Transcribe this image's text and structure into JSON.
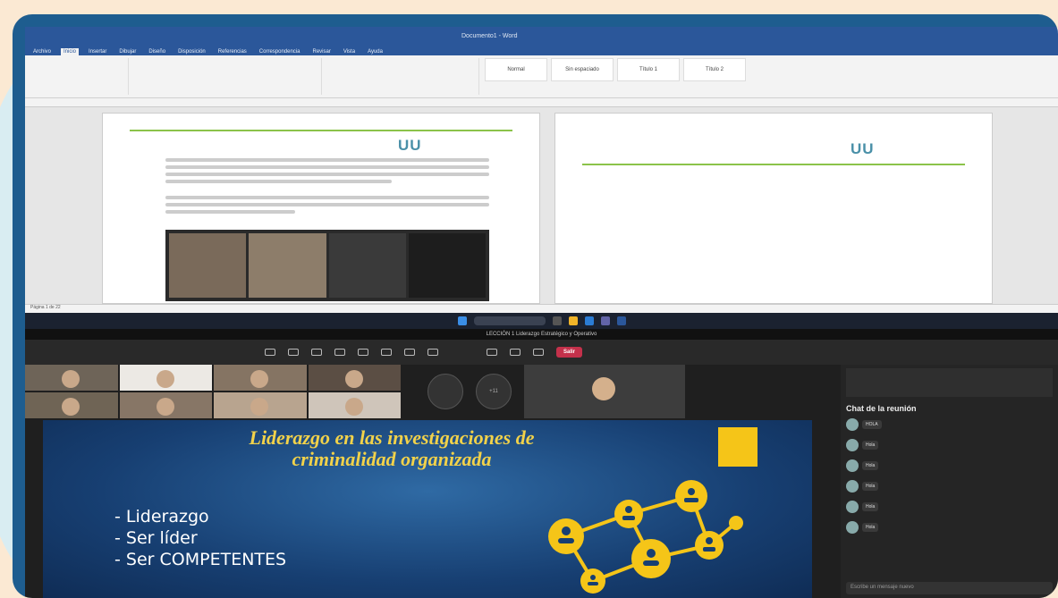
{
  "word": {
    "title": "Documento1 - Word",
    "tabs": [
      "Archivo",
      "Inicio",
      "Insertar",
      "Dibujar",
      "Diseño",
      "Disposición",
      "Referencias",
      "Correspondencia",
      "Revisar",
      "Vista",
      "Ayuda"
    ],
    "active_tab": "Inicio",
    "styles": [
      "Normal",
      "Sin espaciado",
      "Título 1",
      "Título 2"
    ],
    "logo_text": "UU",
    "statusbar": "Página 1 de 22"
  },
  "teams": {
    "meeting_title": "LECCIÓN 1 Liderazgo Estratégico y Operativo",
    "leave_label": "Salir",
    "participant_more": "+11",
    "chat_title": "Chat de la reunión",
    "compose_placeholder": "Escribe un mensaje nuevo",
    "messages": [
      {
        "text": "HOLA"
      },
      {
        "text": "Hola"
      },
      {
        "text": "Hola"
      },
      {
        "text": "Hola"
      },
      {
        "text": "Hola"
      },
      {
        "text": "Hola"
      }
    ]
  },
  "slide": {
    "title_line1": "Liderazgo en las investigaciones de",
    "title_line2": "criminalidad organizada",
    "bullets": [
      "Liderazgo",
      "Ser líder",
      "Ser COMPETENTES"
    ]
  },
  "colors": {
    "frame": "#1e5d8f",
    "word_blue": "#2b579a",
    "slide_title": "#f2d24a",
    "accent_yellow": "#f5c518",
    "leave_red": "#c4314b"
  }
}
